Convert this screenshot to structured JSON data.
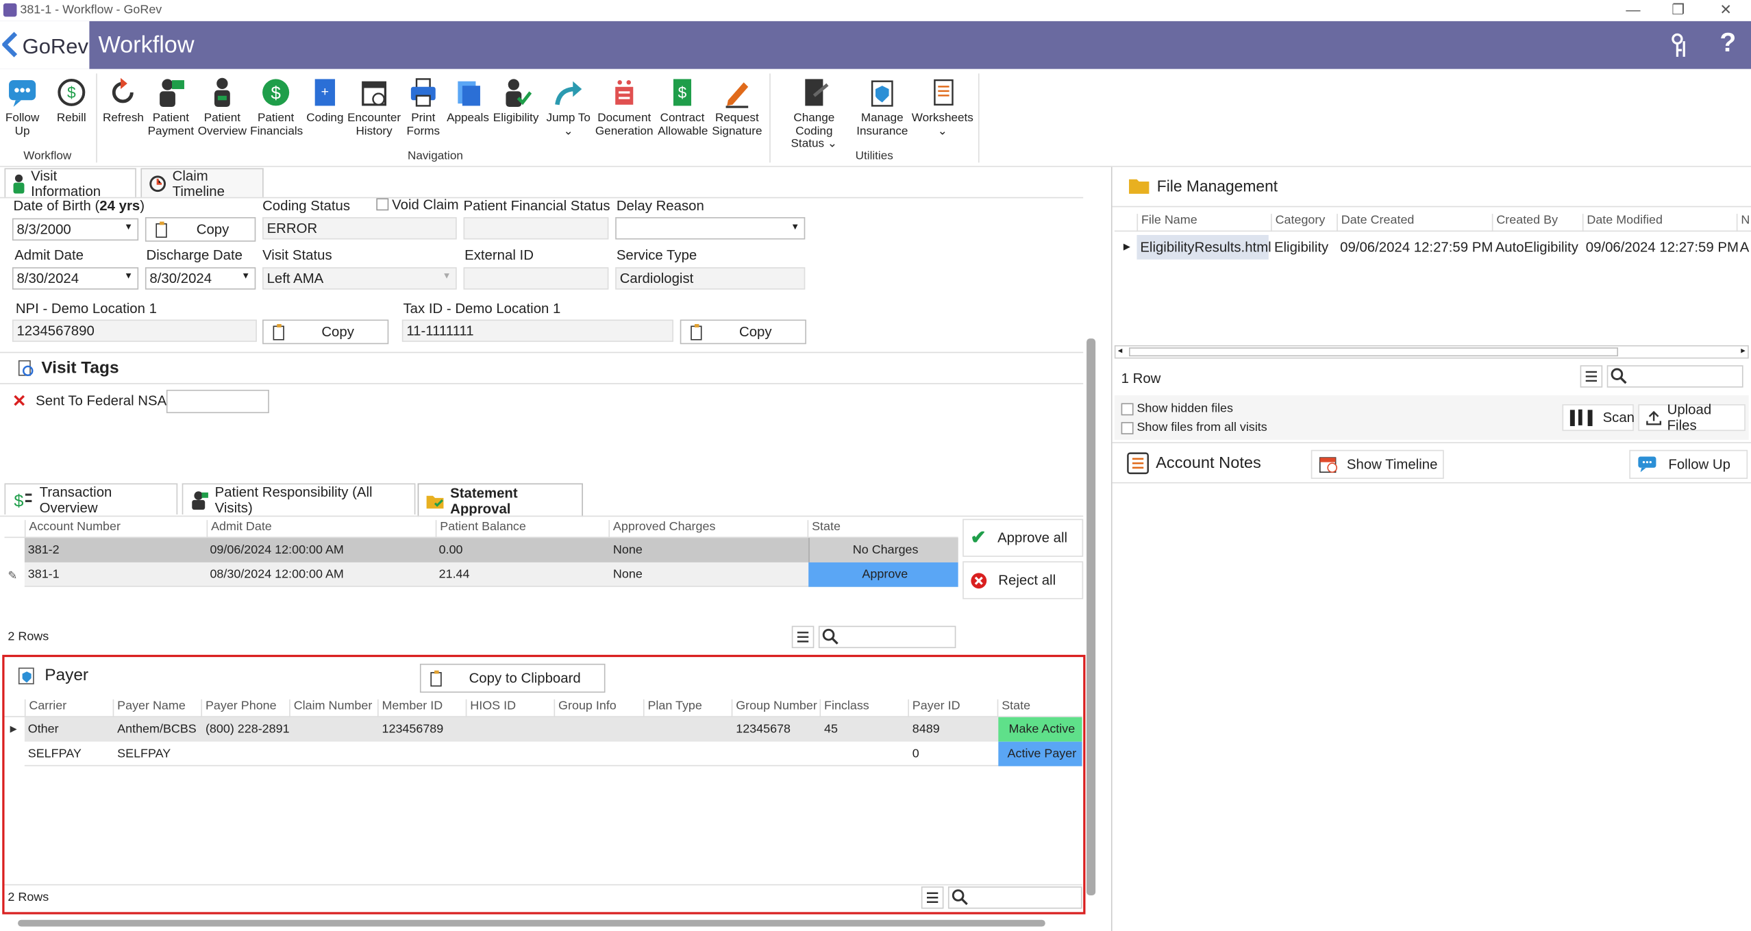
{
  "window": {
    "title": "381-1 - Workflow - GoRev"
  },
  "header": {
    "logo_text": "GoRev",
    "title": "Workflow"
  },
  "ribbon": {
    "workflow": [
      {
        "label1": "Follow",
        "label2": "Up"
      },
      {
        "label1": "Rebill",
        "label2": ""
      }
    ],
    "navigation": [
      {
        "label1": "Refresh",
        "label2": ""
      },
      {
        "label1": "Patient",
        "label2": "Payment"
      },
      {
        "label1": "Patient",
        "label2": "Overview"
      },
      {
        "label1": "Patient",
        "label2": "Financials"
      },
      {
        "label1": "Coding",
        "label2": ""
      },
      {
        "label1": "Encounter",
        "label2": "History"
      },
      {
        "label1": "Print",
        "label2": "Forms"
      },
      {
        "label1": "Appeals",
        "label2": ""
      },
      {
        "label1": "Eligibility",
        "label2": ""
      },
      {
        "label1": "Jump To",
        "label2": "⌄"
      },
      {
        "label1": "Document",
        "label2": "Generation"
      },
      {
        "label1": "Contract",
        "label2": "Allowable"
      },
      {
        "label1": "Request",
        "label2": "Signature"
      }
    ],
    "utilities": [
      {
        "label1": "Change Coding",
        "label2": "Status ⌄"
      },
      {
        "label1": "Manage",
        "label2": "Insurance"
      },
      {
        "label1": "Worksheets",
        "label2": "⌄"
      }
    ],
    "group_workflow": "Workflow",
    "group_navigation": "Navigation",
    "group_utilities": "Utilities"
  },
  "tabs": {
    "visit_info": "Visit Information",
    "claim_timeline": "Claim Timeline"
  },
  "visit": {
    "dob_label": "Date of Birth (",
    "dob_age": "24 yrs",
    "dob_close": ")",
    "dob_value": "8/3/2000",
    "copy": "Copy",
    "coding_status_label": "Coding Status",
    "coding_status_value": "ERROR",
    "void_claim_label": "Void Claim",
    "pfs_label": "Patient Financial Status",
    "pfs_value": "",
    "delay_reason_label": "Delay Reason",
    "admit_date_label": "Admit Date",
    "admit_date_value": "8/30/2024",
    "discharge_date_label": "Discharge Date",
    "discharge_date_value": "8/30/2024",
    "visit_status_label": "Visit Status",
    "visit_status_value": "Left AMA",
    "external_id_label": "External ID",
    "external_id_value": "",
    "service_type_label": "Service Type",
    "service_type_value": "Cardiologist",
    "npi_label": "NPI - Demo Location 1",
    "npi_value": "1234567890",
    "taxid_label": "Tax ID - Demo Location 1",
    "taxid_value": "11-1111111"
  },
  "visit_tags": {
    "title": "Visit Tags",
    "tag_label": "Sent To Federal NSA",
    "tag_value": ""
  },
  "lower_tabs": {
    "transaction": "Transaction Overview",
    "patient_resp": "Patient Responsibility (All Visits)",
    "statement": "Statement Approval"
  },
  "statement": {
    "columns": [
      "Account Number",
      "Admit Date",
      "Patient Balance",
      "Approved Charges",
      "State"
    ],
    "rows": [
      {
        "account": "381-2",
        "admit": "09/06/2024 12:00:00 AM",
        "balance": "0.00",
        "approved": "None",
        "state": "No Charges"
      },
      {
        "account": "381-1",
        "admit": "08/30/2024 12:00:00 AM",
        "balance": "21.44",
        "approved": "None",
        "state": "Approve"
      }
    ],
    "approve_all": "Approve all",
    "reject_all": "Reject all",
    "row_count": "2 Rows"
  },
  "payer": {
    "title": "Payer",
    "copy_clipboard": "Copy to Clipboard",
    "columns": [
      "Carrier",
      "Payer Name",
      "Payer Phone",
      "Claim Number",
      "Member ID",
      "HIOS ID",
      "Group Info",
      "Plan Type",
      "Group Number",
      "Finclass",
      "Payer ID",
      "State"
    ],
    "rows": [
      {
        "carrier": "Other",
        "name": "Anthem/BCBS",
        "phone": "(800) 228-2891",
        "claim": "",
        "member": "123456789",
        "hios": "",
        "group_info": "",
        "plan": "",
        "group_no": "12345678",
        "finclass": "45",
        "payer_id": "8489",
        "state": "Make Active"
      },
      {
        "carrier": "SELFPAY",
        "name": "SELFPAY",
        "phone": "",
        "claim": "",
        "member": "",
        "hios": "",
        "group_info": "",
        "plan": "",
        "group_no": "",
        "finclass": "",
        "payer_id": "0",
        "state": "Active Payer"
      }
    ],
    "row_count": "2 Rows"
  },
  "files": {
    "title": "File Management",
    "columns": [
      "File Name",
      "Category",
      "Date Created",
      "Created By",
      "Date Modified",
      "N"
    ],
    "rows": [
      {
        "name": "EligibilityResults.html",
        "category": "Eligibility",
        "created": "09/06/2024 12:27:59 PM",
        "by": "AutoEligibility",
        "modified": "09/06/2024 12:27:59 PM",
        "n": "A"
      }
    ],
    "row_count": "1 Row",
    "show_hidden": "Show hidden files",
    "show_all": "Show files from all visits",
    "scan": "Scan",
    "upload": "Upload Files"
  },
  "notes": {
    "title": "Account Notes",
    "show_timeline": "Show Timeline",
    "follow_up": "Follow Up"
  },
  "colors": {
    "header": "#6a6aa0",
    "approve_blue": "#5aa6f5",
    "make_active_green": "#5fe08a",
    "selected_row": "#c8c8c8",
    "red_box": "#d92020"
  }
}
